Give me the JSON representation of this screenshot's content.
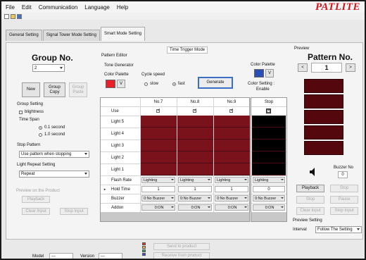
{
  "menu": [
    "File",
    "Edit",
    "Communication",
    "Language",
    "Help"
  ],
  "brand": "PATLITE",
  "tabs": [
    "General Setting",
    "Signal Tower Mode Setting",
    "Smart Mode Setting"
  ],
  "group": {
    "title": "Group No.",
    "value": "2",
    "new_label": "New",
    "copy_label": "Group Copy",
    "paste_label": "Group Paste",
    "setting_label": "Group Setting",
    "blightness_label": "blightness",
    "time_span_label": "Time Span",
    "time_opt1": "0.1 second",
    "time_opt2": "1.0 second",
    "stop_pattern_label": "Stop Pattern",
    "stop_pattern_value": "Use pattern when stopping",
    "repeat_label": "Light Repeat Setting",
    "repeat_value": "Repeat",
    "preview_product_label": "Preview on the Product",
    "playback_label": "Playback",
    "clear_input_label": "Clear Input",
    "stop_input_label": "Stop Input"
  },
  "editor": {
    "mode_label": "Time Trigger Mode",
    "title": "Pattern Editor",
    "tone_generator_label": "Tone Generator",
    "color_palette_label": "Color Palette",
    "cycle_speed_label": "Cycle speed",
    "slow_label": "slow",
    "fast_label": "fast",
    "generate_label": "Generate",
    "color_palette_right_label": "Color Palette",
    "color_setting_label": "Color Setting :",
    "color_setting_value": "Enable",
    "palette_left_color": "#e8202a",
    "palette_right_color": "#2a4fb0",
    "palette_btn": "V"
  },
  "table": {
    "columns": [
      "No.7",
      "No.8",
      "No.9"
    ],
    "stop_header": "Stop",
    "rows": [
      "Use",
      "Light 5",
      "Light 4",
      "Light 3",
      "Light 2",
      "Light 1",
      "Flash Rate",
      "Hold Time",
      "Buzzer",
      "Addon"
    ],
    "flash_rate": [
      "Lighting",
      "Lighting",
      "Lighting",
      "Lighting"
    ],
    "hold_time": [
      "1",
      "1",
      "1",
      "0"
    ],
    "buzzer": [
      "0:No Buzzer",
      "0:No Buzzer",
      "0:No Buzzer",
      "0:No Buzzer"
    ],
    "addon": [
      "0:ON",
      "0:ON",
      "0:ON",
      "0:ON"
    ],
    "light_color": "#7a121c",
    "stop_light_color": "#000000"
  },
  "preview": {
    "section_label": "Preview",
    "title": "Pattern No.",
    "prev": "<",
    "next": ">",
    "value": "1",
    "light_color": "#54070c",
    "buzzer_label": "Buzzer No",
    "buzzer_value": "0",
    "playback_label": "Playback",
    "stop_label": "Stop",
    "stop2_label": "Stop",
    "pause_label": "Pause",
    "clear_input_label": "Clear Input",
    "stop_input_label": "Stop Input",
    "setting_label": "Preview Setting",
    "interval_label": "Interval",
    "interval_value": "Follow The Setting"
  },
  "footer": {
    "model_label": "Model",
    "model_value": "---",
    "version_label": "Version",
    "version_value": "---",
    "send_label": "Send to product",
    "receive_label": "Receive from product"
  }
}
